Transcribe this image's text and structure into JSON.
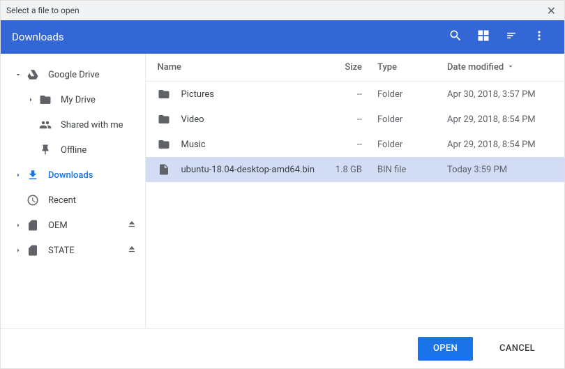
{
  "titlebar": {
    "title": "Select a file to open"
  },
  "toolbar": {
    "location": "Downloads"
  },
  "sidebar": {
    "items": [
      {
        "label": "Google Drive"
      },
      {
        "label": "My Drive"
      },
      {
        "label": "Shared with me"
      },
      {
        "label": "Offline"
      },
      {
        "label": "Downloads"
      },
      {
        "label": "Recent"
      },
      {
        "label": "OEM"
      },
      {
        "label": "STATE"
      }
    ]
  },
  "columns": {
    "name": "Name",
    "size": "Size",
    "type": "Type",
    "date": "Date modified"
  },
  "files": [
    {
      "name": "Pictures",
      "size": "--",
      "type": "Folder",
      "date": "Apr 30, 2018, 3:57 PM"
    },
    {
      "name": "Video",
      "size": "--",
      "type": "Folder",
      "date": "Apr 29, 2018, 8:54 PM"
    },
    {
      "name": "Music",
      "size": "--",
      "type": "Folder",
      "date": "Apr 29, 2018, 8:54 PM"
    },
    {
      "name": "ubuntu-18.04-desktop-amd64.bin",
      "size": "1.8 GB",
      "type": "BIN file",
      "date": "Today 3:59 PM"
    }
  ],
  "footer": {
    "open": "OPEN",
    "cancel": "CANCEL"
  }
}
